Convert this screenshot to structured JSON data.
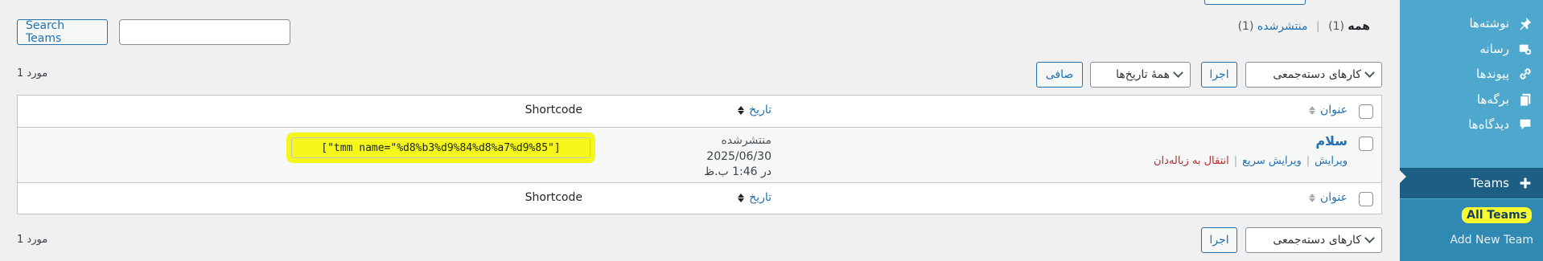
{
  "sidebar": {
    "items": [
      {
        "label": "نوشته‌ها",
        "icon": "pin-icon"
      },
      {
        "label": "رسانه",
        "icon": "media-icon"
      },
      {
        "label": "پیوندها",
        "icon": "link-icon"
      },
      {
        "label": "برگه‌ها",
        "icon": "pages-icon"
      },
      {
        "label": "دیدگاه‌ها",
        "icon": "comment-icon"
      },
      {
        "label": "Teams",
        "icon": "plus-icon"
      }
    ],
    "submenu": {
      "all": "All Teams",
      "add": "Add New Team"
    }
  },
  "subsubsub": {
    "all_label": "همه",
    "all_count": "(1)",
    "separator": "|",
    "published_label": "منتشرشده",
    "published_count": "(1)"
  },
  "search": {
    "button": "Search Teams",
    "value": ""
  },
  "tablenav_top": {
    "bulk_select": "کارهای دسته‌جمعی",
    "apply": "اجرا",
    "dates_select": "همهٔ تاریخ‌ها",
    "filter": "صافی",
    "count": "1 مورد"
  },
  "table": {
    "columns": {
      "title": "عنوان",
      "date": "تاریخ",
      "shortcode": "Shortcode"
    },
    "rows": [
      {
        "title": "سلام",
        "actions": {
          "edit": "ویرایش",
          "quick_edit": "ویرایش سریع",
          "trash": "انتقال به زباله‌دان"
        },
        "status": "منتشرشده",
        "date_line": "2025/06/30",
        "time_line": "در 1:46 ب.ظ",
        "shortcode": "[\"tmm name=\"%d8%b3%d9%84%d8%a7%d9%85\"]"
      }
    ]
  },
  "tablenav_bottom": {
    "bulk_select": "کارهای دسته‌جمعی",
    "apply": "اجرا",
    "count": "1 مورد"
  },
  "colors": {
    "sidebar": "#4ea8cd",
    "sidebar_active": "#1d5e85",
    "submenu": "#2f89b3",
    "link": "#2271b1",
    "trash": "#b32d2e",
    "highlight": "#f5f61a"
  }
}
